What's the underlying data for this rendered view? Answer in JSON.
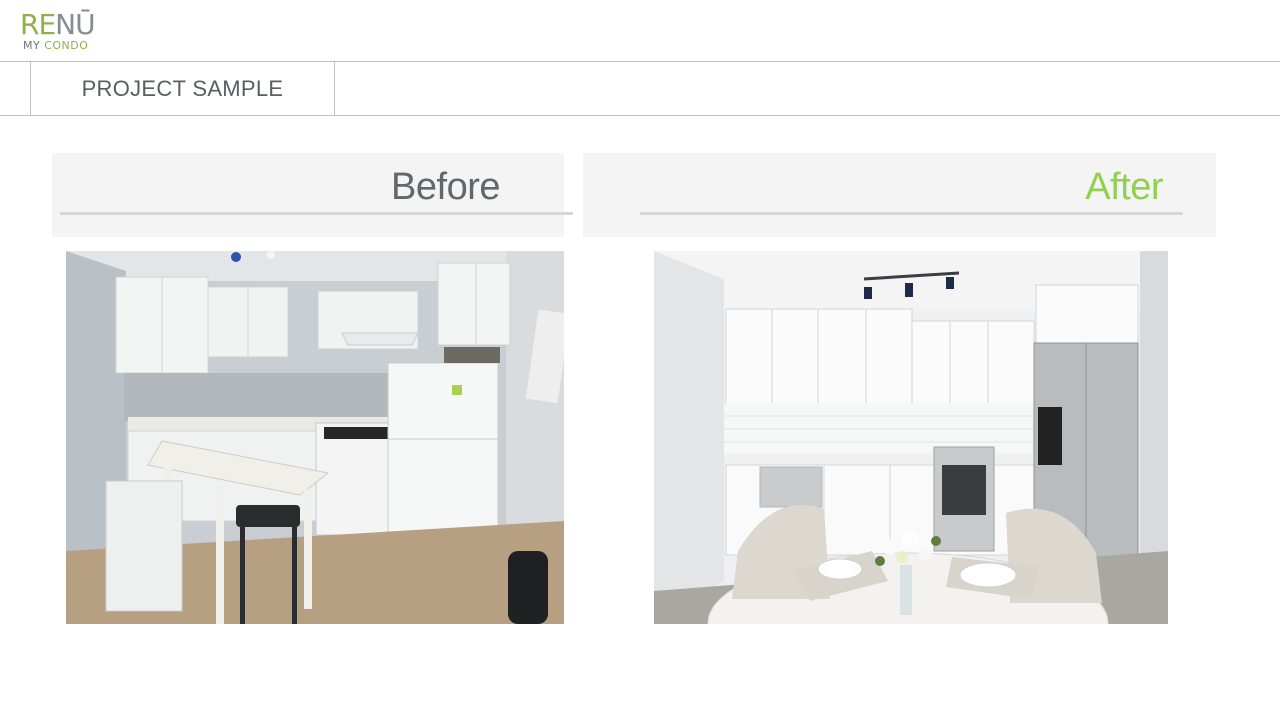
{
  "logo": {
    "word_part1": "RE",
    "word_part2": "NŪ",
    "tag_part1": "MY ",
    "tag_part2": "CONDO",
    "brand_green": "#8db24a",
    "brand_gray": "#888c90"
  },
  "header": {
    "title": "PROJECT SAMPLE"
  },
  "comparison": {
    "before_label": "Before",
    "after_label": "After",
    "after_color": "#92d050"
  },
  "photos": {
    "before_icon": "kitchen-photo-before",
    "after_icon": "kitchen-photo-after"
  }
}
